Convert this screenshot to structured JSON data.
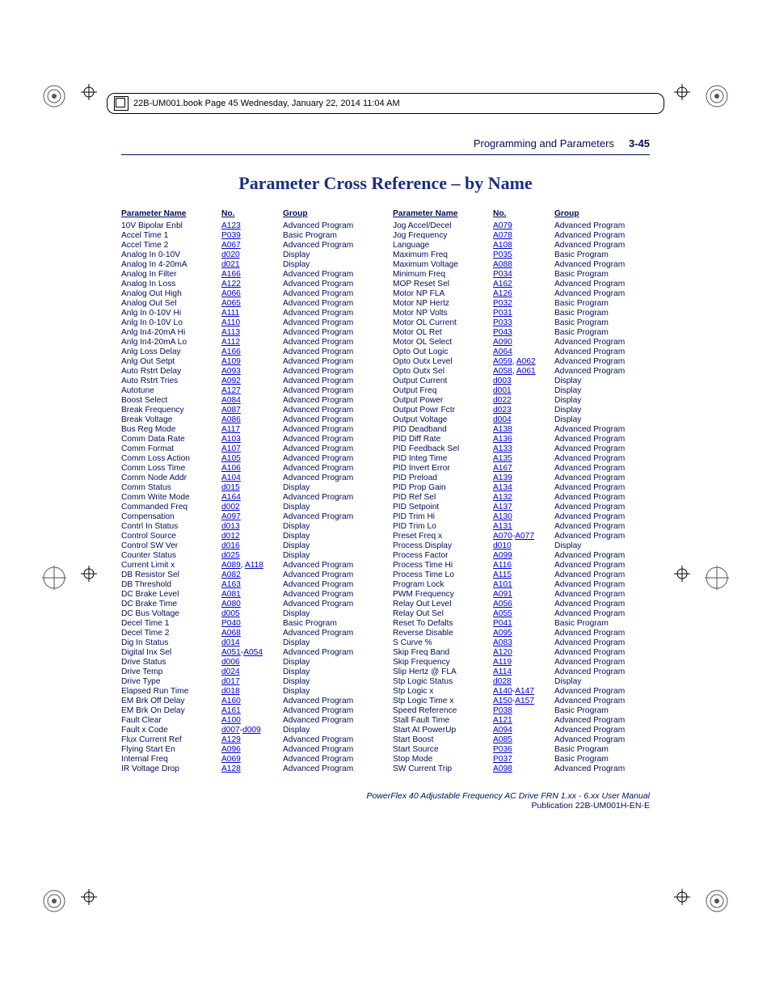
{
  "book_header": "22B-UM001.book  Page 45  Wednesday, January 22, 2014  11:04 AM",
  "running_section": "Programming and Parameters",
  "page_number": "3-45",
  "title": "Parameter Cross Reference – by Name",
  "columns": {
    "headers": {
      "name": "Parameter Name",
      "no": "No.",
      "group": "Group"
    }
  },
  "footer_line1": "PowerFlex 40 Adjustable Frequency AC Drive FRN 1.xx - 6.xx User Manual",
  "footer_line2": "Publication 22B-UM001H-EN-E",
  "left_rows": [
    {
      "name": "10V Bipolar Enbl",
      "no": [
        {
          "t": "A123"
        }
      ],
      "group": "Advanced Program"
    },
    {
      "name": "Accel Time 1",
      "no": [
        {
          "t": "P039"
        }
      ],
      "group": "Basic Program"
    },
    {
      "name": "Accel Time 2",
      "no": [
        {
          "t": "A067"
        }
      ],
      "group": "Advanced Program"
    },
    {
      "name": "Analog In 0-10V",
      "no": [
        {
          "t": "d020"
        }
      ],
      "group": "Display"
    },
    {
      "name": "Analog In 4-20mA",
      "no": [
        {
          "t": "d021"
        }
      ],
      "group": "Display"
    },
    {
      "name": "Analog In Filter",
      "no": [
        {
          "t": "A166"
        }
      ],
      "group": "Advanced Program"
    },
    {
      "name": "Analog In Loss",
      "no": [
        {
          "t": "A122"
        }
      ],
      "group": "Advanced Program"
    },
    {
      "name": "Analog Out High",
      "no": [
        {
          "t": "A066"
        }
      ],
      "group": "Advanced Program"
    },
    {
      "name": "Analog Out Sel",
      "no": [
        {
          "t": "A065"
        }
      ],
      "group": "Advanced Program"
    },
    {
      "name": "Anlg In 0-10V Hi",
      "no": [
        {
          "t": "A111"
        }
      ],
      "group": "Advanced Program"
    },
    {
      "name": "Anlg In 0-10V Lo",
      "no": [
        {
          "t": "A110"
        }
      ],
      "group": "Advanced Program"
    },
    {
      "name": "Anlg In4-20mA Hi",
      "no": [
        {
          "t": "A113"
        }
      ],
      "group": "Advanced Program"
    },
    {
      "name": "Anlg In4-20mA Lo",
      "no": [
        {
          "t": "A112"
        }
      ],
      "group": "Advanced Program"
    },
    {
      "name": "Anlg Loss Delay",
      "no": [
        {
          "t": "A166"
        }
      ],
      "group": "Advanced Program"
    },
    {
      "name": "Anlg Out Setpt",
      "no": [
        {
          "t": "A109"
        }
      ],
      "group": "Advanced Program"
    },
    {
      "name": "Auto Rstrt Delay",
      "no": [
        {
          "t": "A093"
        }
      ],
      "group": "Advanced Program"
    },
    {
      "name": "Auto Rstrt Tries",
      "no": [
        {
          "t": "A092"
        }
      ],
      "group": "Advanced Program"
    },
    {
      "name": "Autotune",
      "no": [
        {
          "t": "A127"
        }
      ],
      "group": "Advanced Program"
    },
    {
      "name": "Boost Select",
      "no": [
        {
          "t": "A084"
        }
      ],
      "group": "Advanced Program"
    },
    {
      "name": "Break Frequency",
      "no": [
        {
          "t": "A087"
        }
      ],
      "group": "Advanced Program"
    },
    {
      "name": "Break Voltage",
      "no": [
        {
          "t": "A086"
        }
      ],
      "group": "Advanced Program"
    },
    {
      "name": "Bus Reg Mode",
      "no": [
        {
          "t": "A117"
        }
      ],
      "group": "Advanced Program"
    },
    {
      "name": "Comm Data Rate",
      "no": [
        {
          "t": "A103"
        }
      ],
      "group": "Advanced Program"
    },
    {
      "name": "Comm Format",
      "no": [
        {
          "t": "A107"
        }
      ],
      "group": "Advanced Program"
    },
    {
      "name": "Comm Loss Action",
      "no": [
        {
          "t": "A105"
        }
      ],
      "group": "Advanced Program"
    },
    {
      "name": "Comm Loss Time",
      "no": [
        {
          "t": "A106"
        }
      ],
      "group": "Advanced Program"
    },
    {
      "name": "Comm Node Addr",
      "no": [
        {
          "t": "A104"
        }
      ],
      "group": "Advanced Program"
    },
    {
      "name": "Comm Status",
      "no": [
        {
          "t": "d015"
        }
      ],
      "group": "Display"
    },
    {
      "name": "Comm Write Mode",
      "no": [
        {
          "t": "A164"
        }
      ],
      "group": "Advanced Program"
    },
    {
      "name": "Commanded Freq",
      "no": [
        {
          "t": "d002"
        }
      ],
      "group": "Display"
    },
    {
      "name": "Compensation",
      "no": [
        {
          "t": "A097"
        }
      ],
      "group": "Advanced Program"
    },
    {
      "name": "Contrl In Status",
      "no": [
        {
          "t": "d013"
        }
      ],
      "group": "Display"
    },
    {
      "name": "Control Source",
      "no": [
        {
          "t": "d012"
        }
      ],
      "group": "Display"
    },
    {
      "name": "Control SW Ver",
      "no": [
        {
          "t": "d016"
        }
      ],
      "group": "Display"
    },
    {
      "name": "Counter Status",
      "no": [
        {
          "t": "d025"
        }
      ],
      "group": "Display"
    },
    {
      "name": "Current Limit x",
      "no": [
        {
          "t": "A089"
        },
        {
          "t": "A118"
        }
      ],
      "sep": ", ",
      "group": "Advanced Program"
    },
    {
      "name": "DB Resistor Sel",
      "no": [
        {
          "t": "A082"
        }
      ],
      "group": "Advanced Program"
    },
    {
      "name": "DB Threshold",
      "no": [
        {
          "t": "A163"
        }
      ],
      "group": "Advanced Program"
    },
    {
      "name": "DC Brake Level",
      "no": [
        {
          "t": "A081"
        }
      ],
      "group": "Advanced Program"
    },
    {
      "name": "DC Brake Time",
      "no": [
        {
          "t": "A080"
        }
      ],
      "group": "Advanced Program"
    },
    {
      "name": "DC Bus Voltage",
      "no": [
        {
          "t": "d005"
        }
      ],
      "group": "Display"
    },
    {
      "name": "Decel Time 1",
      "no": [
        {
          "t": "P040"
        }
      ],
      "group": "Basic Program"
    },
    {
      "name": "Decel Time 2",
      "no": [
        {
          "t": "A068"
        }
      ],
      "group": "Advanced Program"
    },
    {
      "name": "Dig In Status",
      "no": [
        {
          "t": "d014"
        }
      ],
      "group": "Display"
    },
    {
      "name": "Digital Inx Sel",
      "no": [
        {
          "t": "A051"
        },
        {
          "t": "A054"
        }
      ],
      "sep": "-",
      "group": "Advanced Program"
    },
    {
      "name": "Drive Status",
      "no": [
        {
          "t": "d006"
        }
      ],
      "group": "Display"
    },
    {
      "name": "Drive Temp",
      "no": [
        {
          "t": "d024"
        }
      ],
      "group": "Display"
    },
    {
      "name": "Drive Type",
      "no": [
        {
          "t": "d017"
        }
      ],
      "group": "Display"
    },
    {
      "name": "Elapsed Run Time",
      "no": [
        {
          "t": "d018"
        }
      ],
      "group": "Display"
    },
    {
      "name": "EM Brk Off Delay",
      "no": [
        {
          "t": "A160"
        }
      ],
      "group": "Advanced Program"
    },
    {
      "name": "EM Brk On Delay",
      "no": [
        {
          "t": "A161"
        }
      ],
      "group": "Advanced Program"
    },
    {
      "name": "Fault Clear",
      "no": [
        {
          "t": "A100"
        }
      ],
      "group": "Advanced Program"
    },
    {
      "name": "Fault x Code",
      "no": [
        {
          "t": "d007"
        },
        {
          "t": "d009"
        }
      ],
      "sep": "-",
      "group": "Display"
    },
    {
      "name": "Flux Current Ref",
      "no": [
        {
          "t": "A129"
        }
      ],
      "group": "Advanced Program"
    },
    {
      "name": "Flying Start En",
      "no": [
        {
          "t": "A096"
        }
      ],
      "group": "Advanced Program"
    },
    {
      "name": "Internal Freq",
      "no": [
        {
          "t": "A069"
        }
      ],
      "group": "Advanced Program"
    },
    {
      "name": "IR Voltage Drop",
      "no": [
        {
          "t": "A128"
        }
      ],
      "group": "Advanced Program"
    }
  ],
  "right_rows": [
    {
      "name": "Jog Accel/Decel",
      "no": [
        {
          "t": "A079"
        }
      ],
      "group": "Advanced Program"
    },
    {
      "name": "Jog Frequency",
      "no": [
        {
          "t": "A078"
        }
      ],
      "group": "Advanced Program"
    },
    {
      "name": "Language",
      "no": [
        {
          "t": "A108"
        }
      ],
      "group": "Advanced Program"
    },
    {
      "name": "Maximum Freq",
      "no": [
        {
          "t": "P035"
        }
      ],
      "group": "Basic Program"
    },
    {
      "name": "Maximum Voltage",
      "no": [
        {
          "t": "A088"
        }
      ],
      "group": "Advanced Program"
    },
    {
      "name": "Minimum Freq",
      "no": [
        {
          "t": "P034"
        }
      ],
      "group": "Basic Program"
    },
    {
      "name": "MOP Reset Sel",
      "no": [
        {
          "t": "A162"
        }
      ],
      "group": "Advanced Program"
    },
    {
      "name": "Motor NP FLA",
      "no": [
        {
          "t": "A126"
        }
      ],
      "group": "Advanced Program"
    },
    {
      "name": "Motor NP Hertz",
      "no": [
        {
          "t": "P032"
        }
      ],
      "group": "Basic Program"
    },
    {
      "name": "Motor NP Volts",
      "no": [
        {
          "t": "P031"
        }
      ],
      "group": "Basic Program"
    },
    {
      "name": "Motor OL Current",
      "no": [
        {
          "t": "P033"
        }
      ],
      "group": "Basic Program"
    },
    {
      "name": "Motor OL Ret",
      "no": [
        {
          "t": "P043"
        }
      ],
      "group": "Basic Program"
    },
    {
      "name": "Motor OL Select",
      "no": [
        {
          "t": "A090"
        }
      ],
      "group": "Advanced Program"
    },
    {
      "name": "Opto Out Logic",
      "no": [
        {
          "t": "A064"
        }
      ],
      "group": "Advanced Program"
    },
    {
      "name": "Opto Outx Level",
      "no": [
        {
          "t": "A059"
        },
        {
          "t": "A062"
        }
      ],
      "sep": ", ",
      "group": "Advanced Program"
    },
    {
      "name": "Opto Outx Sel",
      "no": [
        {
          "t": "A058"
        },
        {
          "t": "A061"
        }
      ],
      "sep": ", ",
      "group": "Advanced Program"
    },
    {
      "name": "Output Current",
      "no": [
        {
          "t": "d003"
        }
      ],
      "group": "Display"
    },
    {
      "name": "Output Freq",
      "no": [
        {
          "t": "d001"
        }
      ],
      "group": "Display"
    },
    {
      "name": "Output Power",
      "no": [
        {
          "t": "d022"
        }
      ],
      "group": "Display"
    },
    {
      "name": "Output Powr Fctr",
      "no": [
        {
          "t": "d023"
        }
      ],
      "group": "Display"
    },
    {
      "name": "Output Voltage",
      "no": [
        {
          "t": "d004"
        }
      ],
      "group": "Display"
    },
    {
      "name": "PID Deadband",
      "no": [
        {
          "t": "A138"
        }
      ],
      "group": "Advanced Program"
    },
    {
      "name": "PID Diff Rate",
      "no": [
        {
          "t": "A136"
        }
      ],
      "group": "Advanced Program"
    },
    {
      "name": "PID Feedback Sel",
      "no": [
        {
          "t": "A133"
        }
      ],
      "group": "Advanced Program"
    },
    {
      "name": "PID Integ Time",
      "no": [
        {
          "t": "A135"
        }
      ],
      "group": "Advanced Program"
    },
    {
      "name": "PID Invert Error",
      "no": [
        {
          "t": "A167"
        }
      ],
      "group": "Advanced Program"
    },
    {
      "name": "PID Preload",
      "no": [
        {
          "t": "A139"
        }
      ],
      "group": "Advanced Program"
    },
    {
      "name": "PID Prop Gain",
      "no": [
        {
          "t": "A134"
        }
      ],
      "group": "Advanced Program"
    },
    {
      "name": "PID Ref Sel",
      "no": [
        {
          "t": "A132"
        }
      ],
      "group": "Advanced Program"
    },
    {
      "name": "PID Setpoint",
      "no": [
        {
          "t": "A137"
        }
      ],
      "group": "Advanced Program"
    },
    {
      "name": "PID Trim Hi",
      "no": [
        {
          "t": "A130"
        }
      ],
      "group": "Advanced Program"
    },
    {
      "name": "PID Trim Lo",
      "no": [
        {
          "t": "A131"
        }
      ],
      "group": "Advanced Program"
    },
    {
      "name": "Preset Freq x",
      "no": [
        {
          "t": "A070"
        },
        {
          "t": "A077"
        }
      ],
      "sep": "-",
      "group": "Advanced Program"
    },
    {
      "name": "Process Display",
      "no": [
        {
          "t": "d010"
        }
      ],
      "group": "Display"
    },
    {
      "name": "Process Factor",
      "no": [
        {
          "t": "A099"
        }
      ],
      "group": "Advanced Program"
    },
    {
      "name": "Process Time Hi",
      "no": [
        {
          "t": "A116"
        }
      ],
      "group": "Advanced Program"
    },
    {
      "name": "Process Time Lo",
      "no": [
        {
          "t": "A115"
        }
      ],
      "group": "Advanced Program"
    },
    {
      "name": "Program Lock",
      "no": [
        {
          "t": "A101"
        }
      ],
      "group": "Advanced Program"
    },
    {
      "name": "PWM Frequency",
      "no": [
        {
          "t": "A091"
        }
      ],
      "group": "Advanced Program"
    },
    {
      "name": "Relay Out Level",
      "no": [
        {
          "t": "A056"
        }
      ],
      "group": "Advanced Program"
    },
    {
      "name": "Relay Out Sel",
      "no": [
        {
          "t": "A055"
        }
      ],
      "group": "Advanced Program"
    },
    {
      "name": "Reset To Defalts",
      "no": [
        {
          "t": "P041"
        }
      ],
      "group": "Basic Program"
    },
    {
      "name": "Reverse Disable",
      "no": [
        {
          "t": "A095"
        }
      ],
      "group": "Advanced Program"
    },
    {
      "name": "S Curve %",
      "no": [
        {
          "t": "A083"
        }
      ],
      "group": "Advanced Program"
    },
    {
      "name": "Skip Freq Band",
      "no": [
        {
          "t": "A120"
        }
      ],
      "group": "Advanced Program"
    },
    {
      "name": "Skip Frequency",
      "no": [
        {
          "t": "A119"
        }
      ],
      "group": "Advanced Program"
    },
    {
      "name": "Slip Hertz @ FLA",
      "no": [
        {
          "t": "A114"
        }
      ],
      "group": "Advanced Program"
    },
    {
      "name": "Stp Logic Status",
      "no": [
        {
          "t": "d028"
        }
      ],
      "group": "Display"
    },
    {
      "name": "Stp Logic x",
      "no": [
        {
          "t": "A140"
        },
        {
          "t": "A147"
        }
      ],
      "sep": "-",
      "group": "Advanced Program"
    },
    {
      "name": "Stp Logic Time x",
      "no": [
        {
          "t": "A150"
        },
        {
          "t": "A157"
        }
      ],
      "sep": "-",
      "group": "Advanced Program"
    },
    {
      "name": "Speed Reference",
      "no": [
        {
          "t": "P038"
        }
      ],
      "group": "Basic Program"
    },
    {
      "name": "Stall Fault Time",
      "no": [
        {
          "t": "A121"
        }
      ],
      "group": "Advanced Program"
    },
    {
      "name": "Start At PowerUp",
      "no": [
        {
          "t": "A094"
        }
      ],
      "group": "Advanced Program"
    },
    {
      "name": "Start Boost",
      "no": [
        {
          "t": "A085"
        }
      ],
      "group": "Advanced Program"
    },
    {
      "name": "Start Source",
      "no": [
        {
          "t": "P036"
        }
      ],
      "group": "Basic Program"
    },
    {
      "name": "Stop Mode",
      "no": [
        {
          "t": "P037"
        }
      ],
      "group": "Basic Program"
    },
    {
      "name": "SW Current Trip",
      "no": [
        {
          "t": "A098"
        }
      ],
      "group": "Advanced Program"
    }
  ]
}
